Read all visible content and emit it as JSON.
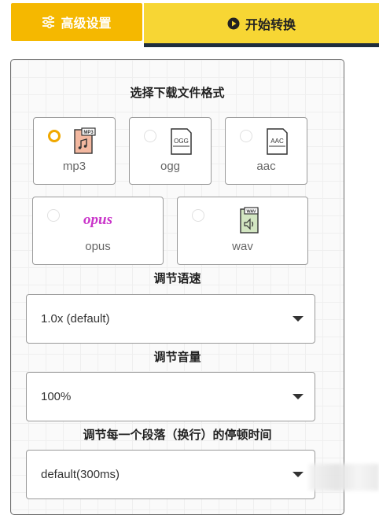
{
  "top_buttons": {
    "advanced_label": "高级设置",
    "start_label": "开始转换"
  },
  "format_section": {
    "title": "选择下载文件格式",
    "options": [
      {
        "label": "mp3",
        "selected": true,
        "icon": "mp3-file-icon",
        "icon_text": "MP3"
      },
      {
        "label": "ogg",
        "selected": false,
        "icon": "ogg-file-icon",
        "icon_text": "OGG"
      },
      {
        "label": "aac",
        "selected": false,
        "icon": "aac-file-icon",
        "icon_text": "AAC"
      },
      {
        "label": "opus",
        "selected": false,
        "icon": "opus-logo",
        "icon_text": "opus"
      },
      {
        "label": "wav",
        "selected": false,
        "icon": "wav-file-icon",
        "icon_text": "WAV"
      }
    ]
  },
  "speed": {
    "title": "调节语速",
    "value": "1.0x (default)"
  },
  "volume": {
    "title": "调节音量",
    "value": "100%"
  },
  "pause": {
    "title": "调节每一个段落（换行）的停顿时间",
    "value": "default(300ms)"
  },
  "colors": {
    "advanced_bg": "#f5b800",
    "start_bg": "#f7d634",
    "start_border": "#1f2d3d",
    "radio_selected": "#f0a800"
  }
}
